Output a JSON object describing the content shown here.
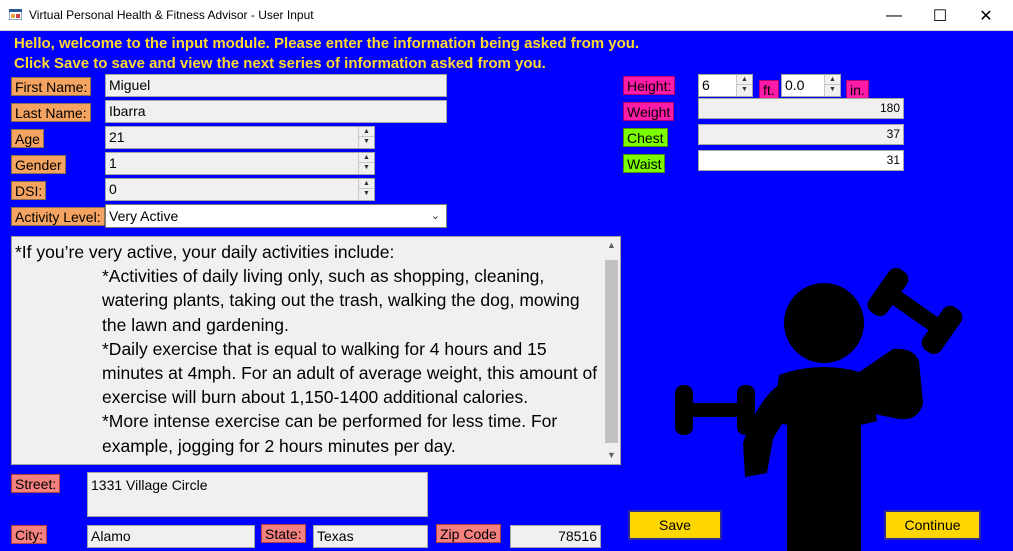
{
  "window": {
    "title": "Virtual Personal Health & Fitness Advisor - User Input",
    "icon": "app-icon",
    "minimize_glyph": "—",
    "maximize_glyph": "☐",
    "close_glyph": "✕"
  },
  "header": {
    "line1": "Hello, welcome to the input module. Please enter the information being asked from you.",
    "line2": "Click Save to save and view the next series of information asked from you."
  },
  "form": {
    "first_name": {
      "label": "First Name:",
      "value": "Miguel"
    },
    "last_name": {
      "label": "Last Name:",
      "value": "Ibarra"
    },
    "age": {
      "label": "Age",
      "value": "21"
    },
    "gender": {
      "label": "Gender",
      "value": "1"
    },
    "dsi": {
      "label": "DSI:",
      "value": "0"
    },
    "activity_level": {
      "label": "Activity Level:",
      "value": "Very Active"
    },
    "height": {
      "label": "Height:",
      "feet": "6",
      "feet_unit": "ft.",
      "inches": "0.0",
      "inches_unit": "in."
    },
    "weight": {
      "label": "Weight",
      "value": "180"
    },
    "chest": {
      "label": "Chest",
      "value": "37"
    },
    "waist": {
      "label": "Waist",
      "value": "31"
    }
  },
  "info_text": {
    "lines": [
      "*If you’re very active, your daily activities include:",
      "*Activities of daily living only, such as shopping, cleaning, watering plants, taking out the trash, walking the dog, mowing the lawn and gardening.",
      "*Daily exercise that is equal to walking for 4 hours and 15 minutes at 4mph.  For an adult of average weight, this amount of exercise will burn about 1,150-1400 additional calories.",
      "*More intense exercise can be performed for less time.  For example, jogging for 2 hours minutes per day."
    ]
  },
  "address": {
    "street": {
      "label": "Street:",
      "value": "1331 Village Circle"
    },
    "city": {
      "label": "City:",
      "value": "Alamo"
    },
    "state": {
      "label": "State:",
      "value": "Texas"
    },
    "zip": {
      "label": "Zip Code",
      "value": "78516"
    }
  },
  "buttons": {
    "save": "Save",
    "continue": "Continue"
  },
  "colors": {
    "background": "#0000ff",
    "header_text": "#ffd92e",
    "label_orange": "#f4a460",
    "label_pink": "#ff1aa8",
    "label_green": "#7cfc00",
    "label_salmon": "#f48080",
    "button": "#ffd700"
  },
  "illustration": {
    "icon": "weightlifter-icon"
  }
}
